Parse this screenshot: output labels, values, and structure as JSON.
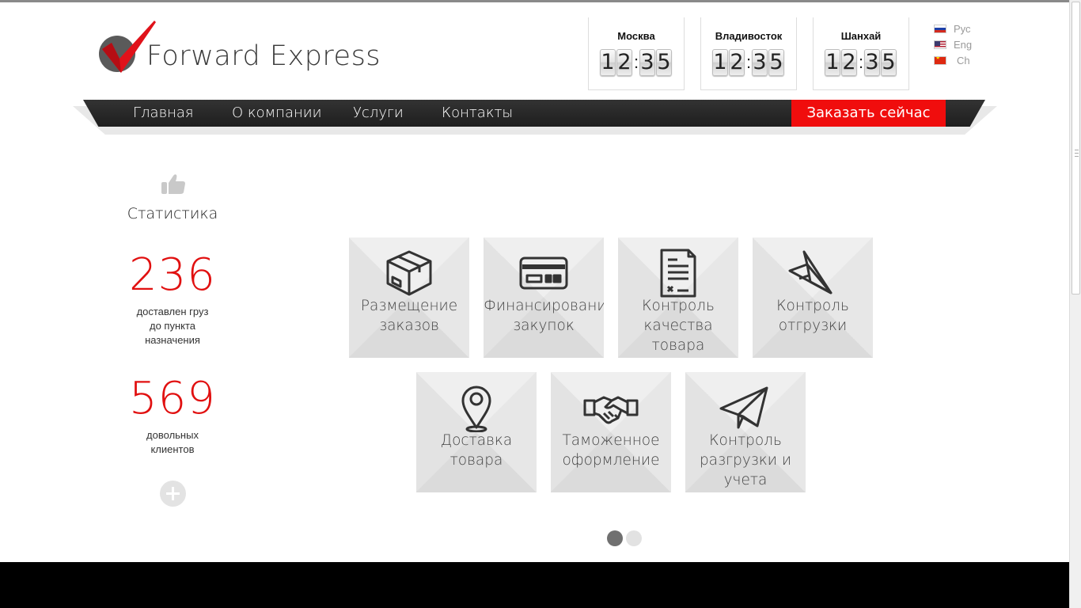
{
  "brand": {
    "name": "Forward Express",
    "colors": {
      "accent": "#f00d0d",
      "nav": "#222222",
      "text": "#333333"
    }
  },
  "clocks": [
    {
      "city": "Москва",
      "h1": "1",
      "h2": "2",
      "m1": "3",
      "m2": "5"
    },
    {
      "city": "Владивосток",
      "h1": "1",
      "h2": "2",
      "m1": "3",
      "m2": "5"
    },
    {
      "city": "Шанхай",
      "h1": "1",
      "h2": "2",
      "m1": "3",
      "m2": "5"
    }
  ],
  "clock_separator": ":",
  "languages": [
    {
      "label": "Рус",
      "flag": "russia-flag-icon"
    },
    {
      "label": "Eng",
      "flag": "usa-flag-icon"
    },
    {
      "label": "Ch",
      "flag": "china-flag-icon"
    }
  ],
  "nav": {
    "items": [
      "Главная",
      "О компании",
      "Услуги",
      "Контакты"
    ],
    "order_button": "Заказать сейчас"
  },
  "stats": {
    "icon": "thumbs-up-icon",
    "title": "Статистика",
    "items": [
      {
        "value": "236",
        "desc_lines": [
          "доставлен груз",
          "до пункта",
          "назначения"
        ]
      },
      {
        "value": "569",
        "desc_lines": [
          "довольных",
          "клиентов"
        ]
      }
    ],
    "more_icon": "plus-circle-icon"
  },
  "services": [
    {
      "icon": "box-icon",
      "lines": [
        "Размещение",
        "заказов"
      ]
    },
    {
      "icon": "credit-card-icon",
      "lines": [
        "Финансирование",
        "закупок"
      ]
    },
    {
      "icon": "document-icon",
      "lines": [
        "Контроль",
        "качества",
        "товара"
      ]
    },
    {
      "icon": "paper-plane-icon",
      "lines": [
        "Контроль",
        "отгрузки"
      ]
    },
    {
      "icon": "map-pin-icon",
      "lines": [
        "Доставка",
        "товара"
      ]
    },
    {
      "icon": "handshake-icon",
      "lines": [
        "Таможенное",
        "оформление"
      ]
    },
    {
      "icon": "send-icon",
      "lines": [
        "Контроль",
        "разгрузки и",
        "учета"
      ]
    }
  ],
  "pager": {
    "pages": 2,
    "active": 1
  }
}
